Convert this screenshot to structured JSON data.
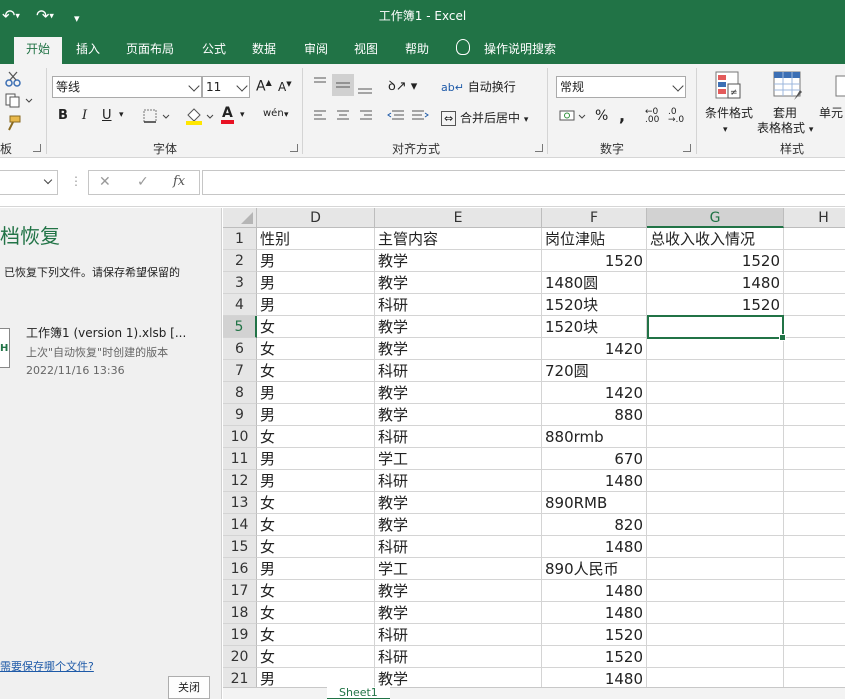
{
  "app": {
    "title": "工作簿1  -  Excel"
  },
  "quick_access": {
    "undo": "↶",
    "redo": "↷",
    "customize": "▾"
  },
  "tabs": [
    {
      "label": "开始",
      "active": true
    },
    {
      "label": "插入"
    },
    {
      "label": "页面布局"
    },
    {
      "label": "公式"
    },
    {
      "label": "数据"
    },
    {
      "label": "审阅"
    },
    {
      "label": "视图"
    },
    {
      "label": "帮助"
    }
  ],
  "tell_me": "操作说明搜索",
  "ribbon": {
    "clipboard_label": "板",
    "font": {
      "name": "等线",
      "size": "11",
      "grow": "A",
      "shrink": "A",
      "bold": "B",
      "italic": "I",
      "underline": "U",
      "font_color": "A",
      "phonetic": "wén",
      "label": "字体"
    },
    "alignment": {
      "wrap": "自动换行",
      "merge": "合并后居中",
      "label": "对齐方式"
    },
    "number": {
      "format": "常规",
      "percent": "%",
      "comma": ",",
      "inc_decimal": ".00",
      "dec_decimal": ".0",
      "label": "数字"
    },
    "styles": {
      "conditional": "条件格式",
      "table_line1": "套用",
      "table_line2": "表格格式",
      "cell_styles": "单元",
      "label": "样式"
    }
  },
  "formula_bar": {
    "cancel": "✕",
    "enter": "✓",
    "fx": "fx",
    "value": ""
  },
  "recovery": {
    "title": "档恢复",
    "description": "已恢复下列文件。请保存希望保留的",
    "file_name": "工作簿1 (version 1).xlsb  [...",
    "file_meta": "上次\"自动恢复\"时创建的版本",
    "file_time": "2022/11/16 13:36",
    "link": "需要保存哪个文件?",
    "close_label": "关闭",
    "icon": "H"
  },
  "grid": {
    "columns": [
      {
        "label": "D"
      },
      {
        "label": "E"
      },
      {
        "label": "F"
      },
      {
        "label": "G",
        "selected": true
      },
      {
        "label": "H"
      }
    ],
    "rows": [
      {
        "n": "1",
        "D": "性别",
        "E": "主管内容",
        "F": "岗位津贴",
        "G": "总收入收入情况"
      },
      {
        "n": "2",
        "D": "男",
        "E": "教学",
        "F": "1520",
        "G": "1520"
      },
      {
        "n": "3",
        "D": "男",
        "E": "教学",
        "F": "1480圆",
        "G": "1480"
      },
      {
        "n": "4",
        "D": "男",
        "E": "科研",
        "F": "1520块",
        "G": "1520"
      },
      {
        "n": "5",
        "D": "女",
        "E": "教学",
        "F": "1520块",
        "G": ""
      },
      {
        "n": "6",
        "D": "女",
        "E": "教学",
        "F": "1420",
        "G": ""
      },
      {
        "n": "7",
        "D": "女",
        "E": "科研",
        "F": "720圆",
        "G": ""
      },
      {
        "n": "8",
        "D": "男",
        "E": "教学",
        "F": "1420",
        "G": ""
      },
      {
        "n": "9",
        "D": "男",
        "E": "教学",
        "F": "880",
        "G": ""
      },
      {
        "n": "10",
        "D": "女",
        "E": "科研",
        "F": "880rmb",
        "G": ""
      },
      {
        "n": "11",
        "D": "男",
        "E": "学工",
        "F": "670",
        "G": ""
      },
      {
        "n": "12",
        "D": "男",
        "E": "科研",
        "F": "1480",
        "G": ""
      },
      {
        "n": "13",
        "D": "女",
        "E": "教学",
        "F": "890RMB",
        "G": ""
      },
      {
        "n": "14",
        "D": "女",
        "E": "教学",
        "F": "820",
        "G": ""
      },
      {
        "n": "15",
        "D": "女",
        "E": "科研",
        "F": "1480",
        "G": ""
      },
      {
        "n": "16",
        "D": "男",
        "E": "学工",
        "F": "890人民币",
        "G": ""
      },
      {
        "n": "17",
        "D": "女",
        "E": "教学",
        "F": "1480",
        "G": ""
      },
      {
        "n": "18",
        "D": "女",
        "E": "教学",
        "F": "1480",
        "G": ""
      },
      {
        "n": "19",
        "D": "女",
        "E": "科研",
        "F": "1520",
        "G": ""
      },
      {
        "n": "20",
        "D": "女",
        "E": "科研",
        "F": "1520",
        "G": ""
      },
      {
        "n": "21",
        "D": "男",
        "E": "教学",
        "F": "1480",
        "G": ""
      }
    ]
  },
  "sheet_tab": "Sheet1"
}
